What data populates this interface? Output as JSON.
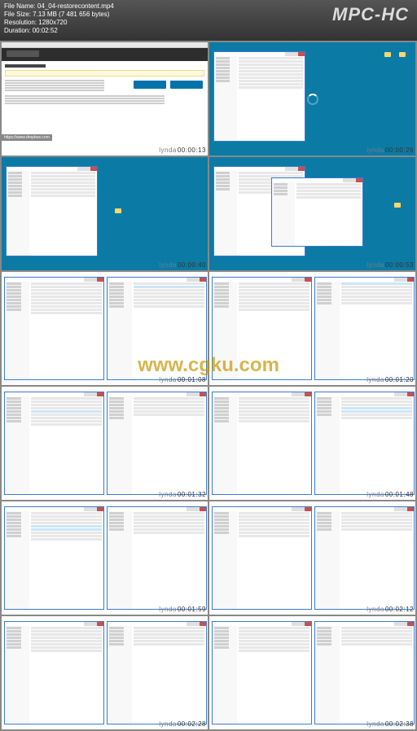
{
  "app": {
    "name": "MPC-HC"
  },
  "meta": {
    "file_name_label": "File Name:",
    "file_name": "04_04-restorecontent.mp4",
    "file_size_label": "File Size:",
    "file_size": "7.13 MB (7 481 656 bytes)",
    "resolution_label": "Resolution:",
    "resolution": "1280x720",
    "duration_label": "Duration:",
    "duration": "00:02:52"
  },
  "watermark": "www.cgku.com",
  "brand": "lynda",
  "dropbox_tag": "https://www.dropbox.com",
  "thumbs": [
    {
      "ts": "00:00:13",
      "kind": "browser"
    },
    {
      "ts": "00:00:26",
      "kind": "desk-2win",
      "loading": true
    },
    {
      "ts": "00:00:40",
      "kind": "desk-2win"
    },
    {
      "ts": "00:00:53",
      "kind": "desk-2win"
    },
    {
      "ts": "00:01:08",
      "kind": "2explorer"
    },
    {
      "ts": "00:01:20",
      "kind": "2explorer"
    },
    {
      "ts": "00:01:32",
      "kind": "2explorer"
    },
    {
      "ts": "00:01:48",
      "kind": "2explorer"
    },
    {
      "ts": "00:01:59",
      "kind": "2explorer"
    },
    {
      "ts": "00:02:12",
      "kind": "2explorer"
    },
    {
      "ts": "00:02:28",
      "kind": "2explorer"
    },
    {
      "ts": "00:02:38",
      "kind": "2explorer"
    }
  ],
  "browser": {
    "site": "WORDPRESS.ORG",
    "heading": "Download WordPress"
  }
}
